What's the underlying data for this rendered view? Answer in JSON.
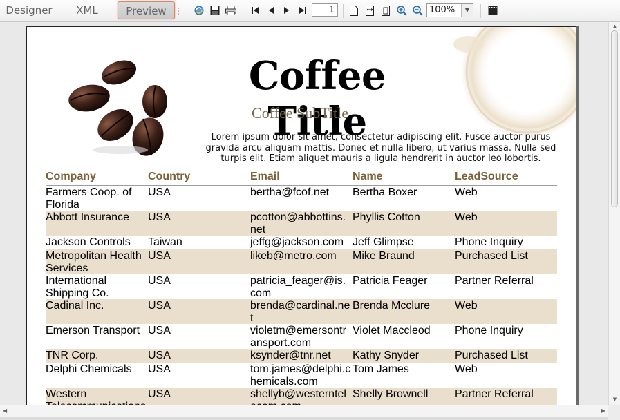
{
  "toolbar": {
    "tabs": {
      "designer": "Designer",
      "xml": "XML",
      "preview": "Preview"
    },
    "page_number": "1",
    "zoom": "100%",
    "icons": [
      "refresh-icon",
      "save-icon",
      "print-icon",
      "first-page-icon",
      "prev-page-icon",
      "next-page-icon",
      "last-page-icon",
      "single-page-icon",
      "page-width-icon",
      "whole-page-icon",
      "zoom-in-icon",
      "zoom-out-icon",
      "film-icon"
    ]
  },
  "report": {
    "title": "Coffee Title",
    "subtitle": "Coffee SubTitle",
    "description": "Lorem ipsum dolor sit amet, consectetur adipiscing elit. Fusce auctor purus gravida arcu aliquam mattis. Donec et nulla libero, ut varius massa. Nulla sed turpis elit. Etiam aliquet mauris a ligula hendrerit in auctor leo lobortis.",
    "columns": [
      "Company",
      "Country",
      "Email",
      "Name",
      "LeadSource"
    ],
    "rows": [
      {
        "company": "Farmers Coop. of Florida",
        "country": "USA",
        "email": "bertha@fcof.net",
        "name": "Bertha Boxer",
        "lead": "Web"
      },
      {
        "company": "Abbott Insurance",
        "country": "USA",
        "email": "pcotton@abbottins.net",
        "name": "Phyllis Cotton",
        "lead": "Web"
      },
      {
        "company": "Jackson Controls",
        "country": "Taiwan",
        "email": "jeffg@jackson.com",
        "name": "Jeff Glimpse",
        "lead": "Phone Inquiry"
      },
      {
        "company": "Metropolitan Health Services",
        "country": "USA",
        "email": "likeb@metro.com",
        "name": "Mike Braund",
        "lead": "Purchased List"
      },
      {
        "company": "International Shipping Co.",
        "country": "USA",
        "email": "patricia_feager@is.com",
        "name": "Patricia Feager",
        "lead": "Partner Referral"
      },
      {
        "company": "Cadinal Inc.",
        "country": "USA",
        "email": "brenda@cardinal.net",
        "name": "Brenda Mcclure",
        "lead": "Web"
      },
      {
        "company": "Emerson Transport",
        "country": "USA",
        "email": "violetm@emersontransport.com",
        "name": "Violet Maccleod",
        "lead": "Phone Inquiry"
      },
      {
        "company": "TNR Corp.",
        "country": "USA",
        "email": "ksynder@tnr.net",
        "name": "Kathy Snyder",
        "lead": "Purchased List"
      },
      {
        "company": "Delphi Chemicals",
        "country": "USA",
        "email": "tom.james@delphi.chemicals.com",
        "name": "Tom James",
        "lead": "Web"
      },
      {
        "company": "Western Telecommunications",
        "country": "USA",
        "email": "shellyb@westerntelecom.com",
        "name": "Shelly Brownell",
        "lead": "Partner Referral"
      }
    ]
  },
  "colors": {
    "header_text": "#7a6138",
    "alt_row": "#eadfcc",
    "preview_border": "#f07a5a"
  }
}
